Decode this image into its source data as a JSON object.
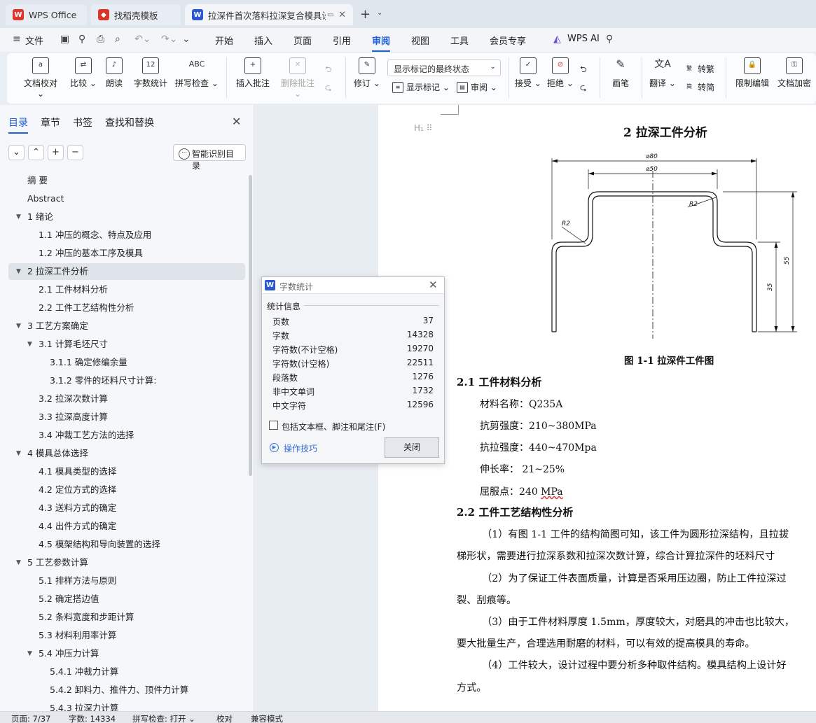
{
  "tabs": [
    {
      "label": "WPS Office"
    },
    {
      "label": "找稻壳模板"
    },
    {
      "label": "拉深件首次落料拉深复合模具设计"
    }
  ],
  "menu": [
    "文件",
    "开始",
    "插入",
    "页面",
    "引用",
    "审阅",
    "视图",
    "工具",
    "会员专享",
    "WPS AI"
  ],
  "ribbon": {
    "doc_check": "文档校对",
    "compare": "比较",
    "read_aloud": "朗读",
    "word_count": "字数统计",
    "spell_check": "拼写检查",
    "insert_comment": "插入批注",
    "delete_comment": "删除批注",
    "track_changes": "修订",
    "markup_state": "显示标记的最终状态",
    "show_markup": "显示标记",
    "review": "审阅",
    "accept": "接受",
    "reject": "拒绝",
    "ink": "画笔",
    "translate": "翻译",
    "to_traditional": "转繁",
    "to_simplified": "转简",
    "restrict_edit": "限制编辑",
    "encrypt": "文档加密",
    "ic_wc": "12",
    "ic_abc": "ABC"
  },
  "nav": {
    "tabs": [
      "目录",
      "章节",
      "书签",
      "查找和替换"
    ],
    "smart_btn": "智能识别目录",
    "toc": [
      {
        "label": "摘 要",
        "level": 1,
        "toggle": ""
      },
      {
        "label": "Abstract",
        "level": 1,
        "toggle": ""
      },
      {
        "label": "1  绪论",
        "level": 1,
        "toggle": "▼"
      },
      {
        "label": "1.1   冲压的概念、特点及应用",
        "level": 2,
        "toggle": ""
      },
      {
        "label": "1.2   冲压的基本工序及模具",
        "level": 2,
        "toggle": ""
      },
      {
        "label": "2  拉深工件分析",
        "level": 1,
        "toggle": "▼"
      },
      {
        "label": "2.1  工件材料分析",
        "level": 2,
        "toggle": ""
      },
      {
        "label": "2.2  工件工艺结构性分析",
        "level": 2,
        "toggle": ""
      },
      {
        "label": "3 工艺方案确定",
        "level": 1,
        "toggle": "▼"
      },
      {
        "label": "3.1  计算毛坯尺寸",
        "level": 2,
        "toggle": "▼"
      },
      {
        "label": "3.1.1 确定修编余量",
        "level": 3,
        "toggle": ""
      },
      {
        "label": "3.1.2 零件的坯料尺寸计算:",
        "level": 3,
        "toggle": ""
      },
      {
        "label": "3.2  拉深次数计算",
        "level": 2,
        "toggle": ""
      },
      {
        "label": "3.3 拉深高度计算",
        "level": 2,
        "toggle": ""
      },
      {
        "label": "3.4 冲裁工艺方法的选择",
        "level": 2,
        "toggle": ""
      },
      {
        "label": "4  模具总体选择",
        "level": 1,
        "toggle": "▼"
      },
      {
        "label": "4.1  模具类型的选择",
        "level": 2,
        "toggle": ""
      },
      {
        "label": "4.2  定位方式的选择",
        "level": 2,
        "toggle": ""
      },
      {
        "label": "4.3  送料方式的确定",
        "level": 2,
        "toggle": ""
      },
      {
        "label": "4.4  出件方式的确定",
        "level": 2,
        "toggle": ""
      },
      {
        "label": "4.5 模架结构和导向装置的选择",
        "level": 2,
        "toggle": ""
      },
      {
        "label": "5  工艺参数计算",
        "level": 1,
        "toggle": "▼"
      },
      {
        "label": "5.1 排样方法与原则",
        "level": 2,
        "toggle": ""
      },
      {
        "label": "5.2  确定搭边值",
        "level": 2,
        "toggle": ""
      },
      {
        "label": "5.2  条料宽度和步距计算",
        "level": 2,
        "toggle": ""
      },
      {
        "label": "5.3  材料利用率计算",
        "level": 2,
        "toggle": ""
      },
      {
        "label": "5.4  冲压力计算",
        "level": 2,
        "toggle": "▼"
      },
      {
        "label": "5.4.1 冲裁力计算",
        "level": 3,
        "toggle": ""
      },
      {
        "label": "5.4.2 卸料力、推件力、顶件力计算",
        "level": 3,
        "toggle": ""
      },
      {
        "label": "5.4.3 拉深力计算",
        "level": 3,
        "toggle": ""
      }
    ]
  },
  "document": {
    "heading_mark": "H₁ ⠿",
    "title": "2  拉深工件分析",
    "figure_caption": "图 1-1 拉深件工件图",
    "drawing": {
      "d_outer": "⌀80",
      "d_inner": "⌀50",
      "r_upper": "R2",
      "r_lower": "R2",
      "h_total": "55",
      "h_step": "35"
    },
    "sec21_title": "2.1  工件材料分析",
    "props": [
      {
        "text": "材料名称：Q235A"
      },
      {
        "text": "抗剪强度：210~380MPa"
      },
      {
        "text": "抗拉强度：440~470Mpa"
      },
      {
        "text": "伸长率：  21~25%"
      },
      {
        "text": "屈服点：240 ",
        "suffix": "MPa"
      }
    ],
    "sec22_title": "2.2  工件工艺结构性分析",
    "paras": [
      "（1）有图 1-1 工件的结构简图可知，该工件为圆形拉深结构，且拉拔",
      "梯形状，需要进行拉深系数和拉深次数计算，综合计算拉深件的坯料尺寸",
      "（2）为了保证工件表面质量，计算是否采用压边圈，防止工件拉深过",
      "裂、刮痕等。",
      "（3）由于工件材料厚度 1.5mm，厚度较大，对磨具的冲击也比较大，",
      "要大批量生产，合理选用耐磨的材料，可以有效的提高模具的寿命。",
      "（4）工件较大，设计过程中要分析多种取件结构。模具结构上设计好",
      "方式。"
    ]
  },
  "dialog": {
    "title": "字数统计",
    "group": "统计信息",
    "stats": [
      {
        "label": "页数",
        "value": "37"
      },
      {
        "label": "字数",
        "value": "14328"
      },
      {
        "label": "字符数(不计空格)",
        "value": "19270"
      },
      {
        "label": "字符数(计空格)",
        "value": "22511"
      },
      {
        "label": "段落数",
        "value": "1276"
      },
      {
        "label": "非中文单词",
        "value": "1732"
      },
      {
        "label": "中文字符",
        "value": "12596"
      }
    ],
    "checkbox_label": "包括文本框、脚注和尾注(F)",
    "tips": "操作技巧",
    "close": "关闭"
  },
  "status": {
    "page": "页面: 7/37",
    "words": "字数: 14334",
    "spell": "拼写检查: 打开 ⌄",
    "proof": "校对",
    "compat": "兼容模式"
  },
  "colors": {
    "accent": "#1f5fd6",
    "wps_red": "#e0362c",
    "docer_red": "#d9352b",
    "wps_blue": "#2b57d4"
  }
}
